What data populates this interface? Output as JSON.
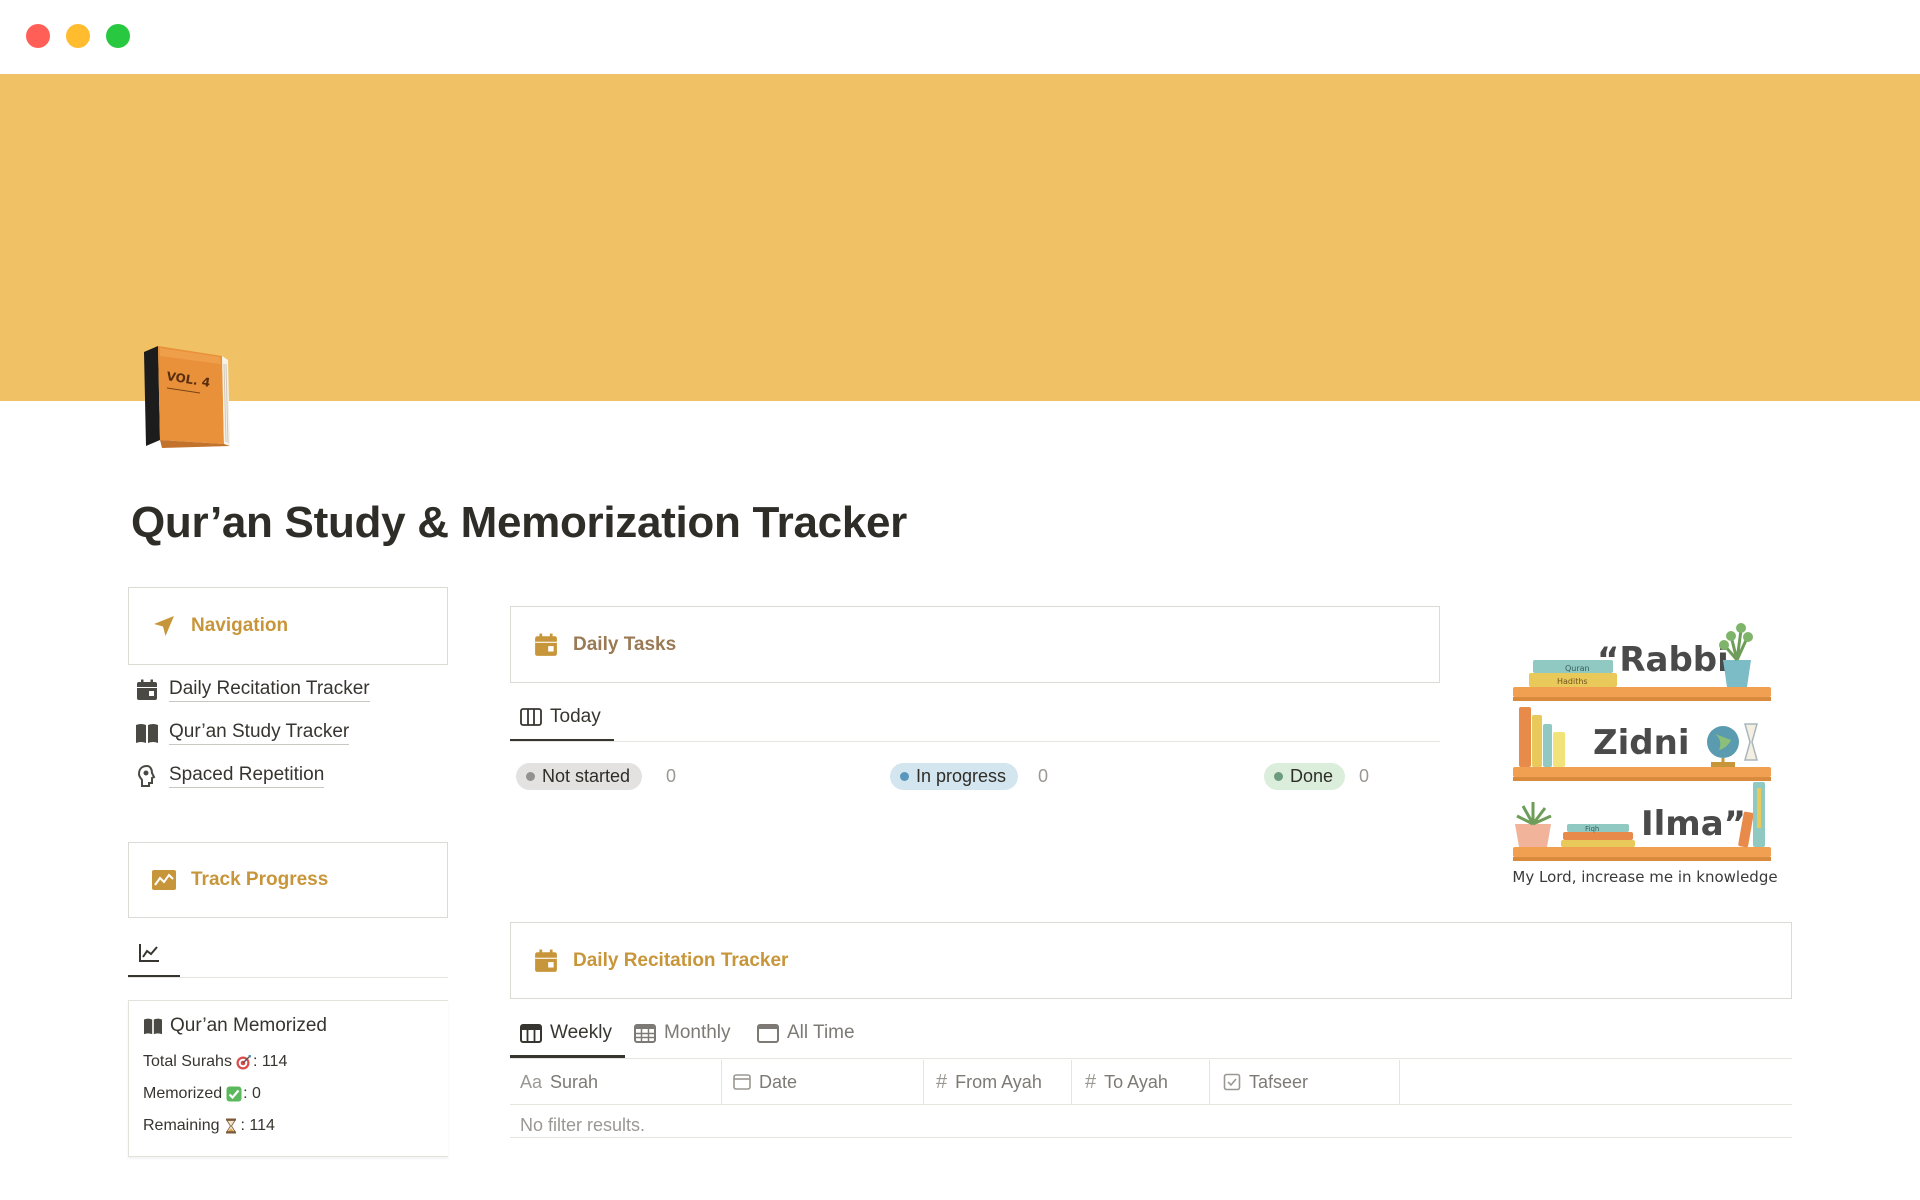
{
  "window": {
    "controls": [
      "close",
      "minimize",
      "zoom"
    ]
  },
  "cover": {
    "color": "#f0c165"
  },
  "page": {
    "icon": "orange-book-icon",
    "icon_text": "VOL. 4",
    "title": "Qur’an Study & Memorization Tracker"
  },
  "colors": {
    "accent": "#c8963a",
    "accent_brown": "#9a7a55",
    "not_started_bg": "#e3e2e0",
    "not_started_dot": "#91918e",
    "in_progress_bg": "#d3e5ef",
    "in_progress_dot": "#5b97bd",
    "done_bg": "#dbeddb",
    "done_dot": "#6c9b7d"
  },
  "navigation": {
    "callout_label": "Navigation",
    "icon": "navigation-arrow-icon",
    "links": [
      {
        "label": "Daily Recitation Tracker",
        "icon": "calendar-icon"
      },
      {
        "label": "Qur’an Study Tracker",
        "icon": "open-book-icon"
      },
      {
        "label": "Spaced Repetition",
        "icon": "brain-head-icon"
      }
    ]
  },
  "track_progress": {
    "callout_label": "Track Progress",
    "icon": "chart-card-icon",
    "tab_icon": "line-chart-icon",
    "card": {
      "title": "Qur’an Memorized",
      "icon": "open-book-icon",
      "rows": [
        {
          "label": "Total Surahs",
          "emoji": "dart-icon",
          "value": ": 114"
        },
        {
          "label": "Memorized",
          "emoji": "check-mark-icon",
          "value": ": 0"
        },
        {
          "label": "Remaining",
          "emoji": "hourglass-icon",
          "value": ": 114"
        }
      ]
    }
  },
  "daily_tasks": {
    "callout_label": "Daily Tasks",
    "icon": "calendar-icon",
    "tab_label": "Today",
    "tab_icon": "board-icon",
    "groups": [
      {
        "label": "Not started",
        "count": "0"
      },
      {
        "label": "In progress",
        "count": "0"
      },
      {
        "label": "Done",
        "count": "0"
      }
    ]
  },
  "recitation": {
    "callout_label": "Daily Recitation Tracker",
    "icon": "calendar-icon",
    "tabs": [
      {
        "label": "Weekly",
        "icon": "week-calendar-icon",
        "active": true
      },
      {
        "label": "Monthly",
        "icon": "grid-calendar-icon",
        "active": false
      },
      {
        "label": "All Time",
        "icon": "calendar-outline-icon",
        "active": false
      }
    ],
    "columns": [
      {
        "label": "Surah",
        "prefix": "Aa",
        "icon": "title-property-icon"
      },
      {
        "label": "Date",
        "icon": "date-property-icon"
      },
      {
        "label": "From Ayah",
        "prefix": "#",
        "icon": "number-property-icon"
      },
      {
        "label": "To Ayah",
        "prefix": "#",
        "icon": "number-property-icon"
      },
      {
        "label": "Tafseer",
        "icon": "checkbox-property-icon"
      }
    ],
    "empty_text": "No filter results."
  },
  "illustration": {
    "line1": "“Rabbi",
    "line2": "Zidni",
    "line3": "Ilma”",
    "book_label_1": "Quran",
    "book_label_2": "Hadiths",
    "book_label_3": "Fiqh",
    "caption": "My Lord, increase me in knowledge"
  }
}
